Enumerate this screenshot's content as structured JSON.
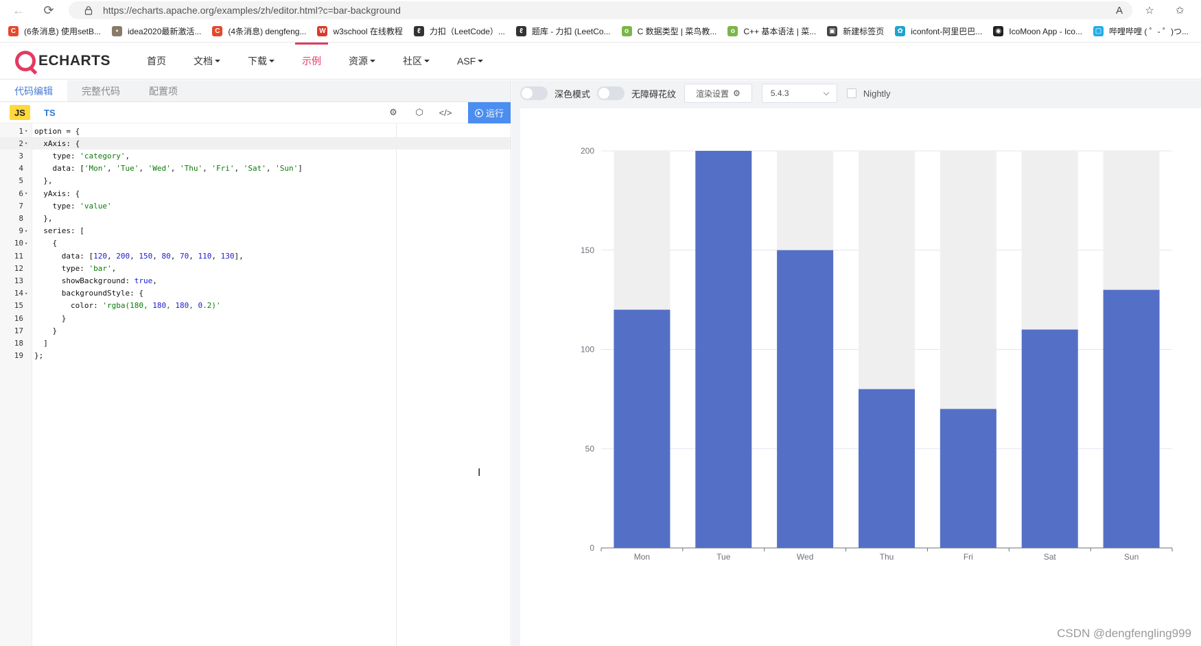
{
  "browser": {
    "url": "https://echarts.apache.org/examples/zh/editor.html?c=bar-background",
    "bookmarks": [
      {
        "label": "(6条消息) 使用setB...",
        "icon": "csdn-icon",
        "color": "#e5482c",
        "glyph": "C"
      },
      {
        "label": "idea2020最新激活...",
        "icon": "image-icon",
        "color": "#8a7a6a",
        "glyph": "▪"
      },
      {
        "label": "(4条消息) dengfeng...",
        "icon": "csdn-icon",
        "color": "#e5482c",
        "glyph": "C"
      },
      {
        "label": "w3school 在线教程",
        "icon": "w3school-icon",
        "color": "#d63b2b",
        "glyph": "W"
      },
      {
        "label": "力扣（LeetCode）...",
        "icon": "leetcode-icon",
        "color": "#333333",
        "glyph": "ℓ"
      },
      {
        "label": "题库 - 力扣 (LeetCo...",
        "icon": "leetcode-icon",
        "color": "#333333",
        "glyph": "ℓ"
      },
      {
        "label": "C 数据类型 | 菜鸟教...",
        "icon": "runoob-icon",
        "color": "#7ab648",
        "glyph": "o"
      },
      {
        "label": "C++ 基本语法 | 菜...",
        "icon": "runoob-icon",
        "color": "#7ab648",
        "glyph": "o"
      },
      {
        "label": "新建标签页",
        "icon": "newtab-icon",
        "color": "#444444",
        "glyph": "▣"
      },
      {
        "label": "iconfont-阿里巴巴...",
        "icon": "iconfont-icon",
        "color": "#1fa3d1",
        "glyph": "✿"
      },
      {
        "label": "IcoMoon App - Ico...",
        "icon": "icomoon-icon",
        "color": "#222222",
        "glyph": "◉"
      },
      {
        "label": "哔哩哔哩 ( ゜- ゜)つ...",
        "icon": "bilibili-icon",
        "color": "#23ade5",
        "glyph": "▢"
      }
    ]
  },
  "site": {
    "logo_text": "ECHARTS",
    "menu": [
      {
        "label": "首页",
        "dropdown": false,
        "active": false
      },
      {
        "label": "文档",
        "dropdown": true,
        "active": false
      },
      {
        "label": "下载",
        "dropdown": true,
        "active": false
      },
      {
        "label": "示例",
        "dropdown": false,
        "active": true
      },
      {
        "label": "资源",
        "dropdown": true,
        "active": false
      },
      {
        "label": "社区",
        "dropdown": true,
        "active": false
      },
      {
        "label": "ASF",
        "dropdown": true,
        "active": false
      }
    ]
  },
  "editor": {
    "tabs": [
      "代码编辑",
      "完整代码",
      "配置项"
    ],
    "active_tab": 0,
    "langs": [
      "JS",
      "TS"
    ],
    "run_label": "运行",
    "current_line": 2,
    "lines": [
      {
        "n": 1,
        "fold": true,
        "text": "option = {"
      },
      {
        "n": 2,
        "fold": true,
        "text": "  xAxis: {"
      },
      {
        "n": 3,
        "fold": false,
        "text": "    type: 'category',"
      },
      {
        "n": 4,
        "fold": false,
        "text": "    data: ['Mon', 'Tue', 'Wed', 'Thu', 'Fri', 'Sat', 'Sun']"
      },
      {
        "n": 5,
        "fold": false,
        "text": "  },"
      },
      {
        "n": 6,
        "fold": true,
        "text": "  yAxis: {"
      },
      {
        "n": 7,
        "fold": false,
        "text": "    type: 'value'"
      },
      {
        "n": 8,
        "fold": false,
        "text": "  },"
      },
      {
        "n": 9,
        "fold": true,
        "text": "  series: ["
      },
      {
        "n": 10,
        "fold": true,
        "text": "    {"
      },
      {
        "n": 11,
        "fold": false,
        "text": "      data: [120, 200, 150, 80, 70, 110, 130],"
      },
      {
        "n": 12,
        "fold": false,
        "text": "      type: 'bar',"
      },
      {
        "n": 13,
        "fold": false,
        "text": "      showBackground: true,"
      },
      {
        "n": 14,
        "fold": true,
        "text": "      backgroundStyle: {"
      },
      {
        "n": 15,
        "fold": false,
        "text": "        color: 'rgba(180, 180, 180, 0.2)'"
      },
      {
        "n": 16,
        "fold": false,
        "text": "      }"
      },
      {
        "n": 17,
        "fold": false,
        "text": "    }"
      },
      {
        "n": 18,
        "fold": false,
        "text": "  ]"
      },
      {
        "n": 19,
        "fold": false,
        "text": "};"
      }
    ]
  },
  "preview": {
    "dark_mode_label": "深色模式",
    "decal_label": "无障碍花纹",
    "render_label": "渲染设置",
    "version": "5.4.3",
    "nightly_label": "Nightly",
    "watermark": "CSDN @dengfengling999"
  },
  "chart_data": {
    "type": "bar",
    "categories": [
      "Mon",
      "Tue",
      "Wed",
      "Thu",
      "Fri",
      "Sat",
      "Sun"
    ],
    "values": [
      120,
      200,
      150,
      80,
      70,
      110,
      130
    ],
    "ylim": [
      0,
      200
    ],
    "yticks": [
      0,
      50,
      100,
      150,
      200
    ],
    "show_background": true,
    "bar_color": "#5470c6",
    "background_color": "#efefef",
    "grid": true,
    "legend": "none"
  }
}
